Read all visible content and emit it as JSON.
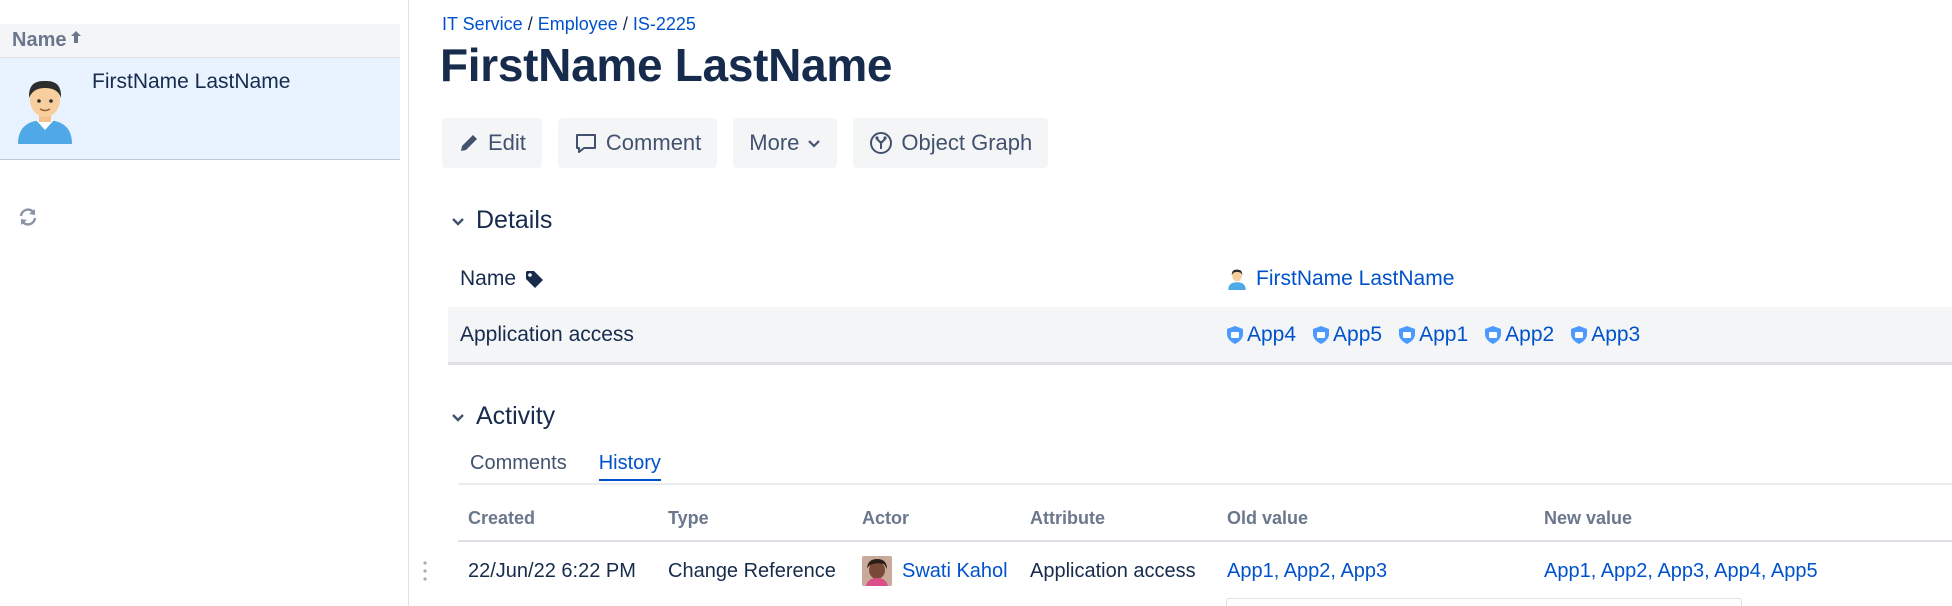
{
  "list": {
    "header_label": "Name",
    "rows": [
      {
        "name": "FirstName LastName"
      }
    ]
  },
  "breadcrumb": [
    "IT Service",
    "Employee",
    "IS-2225"
  ],
  "breadcrumb_separator": "/",
  "title": "FirstName LastName",
  "toolbar": {
    "edit_label": "Edit",
    "comment_label": "Comment",
    "more_label": "More",
    "object_graph_label": "Object Graph"
  },
  "details": {
    "heading": "Details",
    "rows": [
      {
        "label": "Name",
        "value": "FirstName LastName"
      },
      {
        "label": "Application access",
        "apps": [
          "App4",
          "App5",
          "App1",
          "App2",
          "App3"
        ]
      }
    ]
  },
  "activity": {
    "heading": "Activity",
    "tabs": [
      "Comments",
      "History"
    ],
    "active_tab": "History",
    "columns": [
      "Created",
      "Type",
      "Actor",
      "Attribute",
      "Old value",
      "New value"
    ],
    "rows": [
      {
        "created": "22/Jun/22 6:22 PM",
        "type": "Change Reference",
        "actor": "Swati Kahol",
        "attribute": "Application access",
        "old_value": "App1, App2, App3",
        "new_value": "App1, App2, App3, App4, App5"
      }
    ]
  },
  "icons": {
    "sort": "arrow-up-icon",
    "refresh": "refresh-icon",
    "edit": "pencil-icon",
    "comment": "comment-icon",
    "more": "chevron-down-icon",
    "graph": "graph-icon",
    "tag": "tag-icon",
    "app": "shield-icon"
  },
  "colors": {
    "link": "#0052cc",
    "text": "#172b4d",
    "selected_row": "#e9f2ff",
    "button_bg": "#f4f5f7"
  }
}
